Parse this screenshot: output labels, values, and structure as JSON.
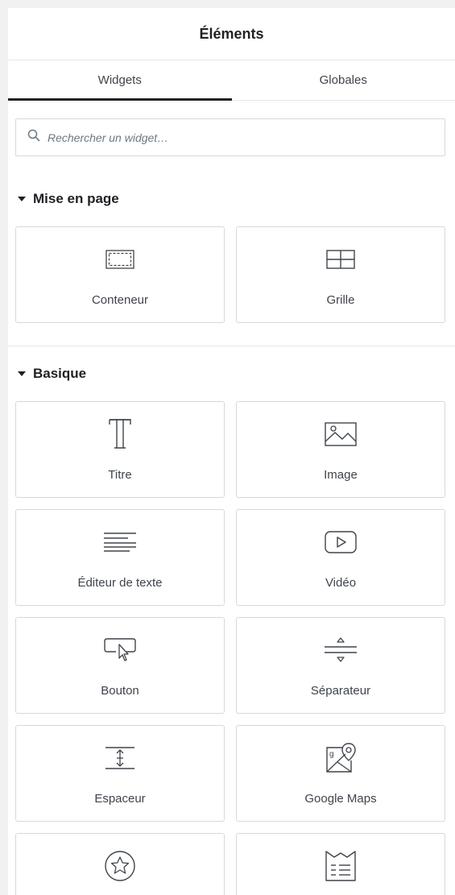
{
  "panel": {
    "title": "Éléments"
  },
  "tabs": [
    {
      "label": "Widgets",
      "active": true
    },
    {
      "label": "Globales",
      "active": false
    }
  ],
  "search": {
    "placeholder": "Rechercher un widget…",
    "value": ""
  },
  "sections": [
    {
      "title": "Mise en page",
      "widgets": [
        {
          "label": "Conteneur",
          "icon": "container-icon"
        },
        {
          "label": "Grille",
          "icon": "grid-icon"
        }
      ]
    },
    {
      "title": "Basique",
      "widgets": [
        {
          "label": "Titre",
          "icon": "heading-icon"
        },
        {
          "label": "Image",
          "icon": "image-icon"
        },
        {
          "label": "Éditeur de texte",
          "icon": "text-editor-icon"
        },
        {
          "label": "Vidéo",
          "icon": "video-icon"
        },
        {
          "label": "Bouton",
          "icon": "button-icon"
        },
        {
          "label": "Séparateur",
          "icon": "divider-icon"
        },
        {
          "label": "Espaceur",
          "icon": "spacer-icon"
        },
        {
          "label": "Google Maps",
          "icon": "google-maps-icon"
        },
        {
          "label": "",
          "icon": "star-icon"
        },
        {
          "label": "",
          "icon": "table-of-contents-icon"
        }
      ]
    }
  ],
  "colors": {
    "text": "#1f2124",
    "border": "#d5d8dc",
    "icon": "#3f444b"
  }
}
